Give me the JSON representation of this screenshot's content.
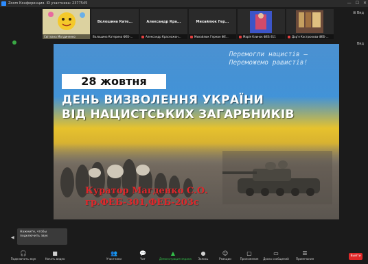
{
  "window": {
    "title": "Zoom Конференция. ID участника: 2377545",
    "controls": [
      "—",
      "☐",
      "✕"
    ]
  },
  "view_label": "⊞ Вид",
  "view_label_2": "Вид",
  "participants": [
    {
      "display": "",
      "name": "Світлана Магдиненко",
      "muted": false,
      "kind": "avatar"
    },
    {
      "display": "Волошина Кате...",
      "name": "Волошина Катерина ФЕБ-...",
      "muted": false,
      "kind": "text"
    },
    {
      "display": "Александр Кра...",
      "name": "Александр Красножон...",
      "muted": true,
      "kind": "text"
    },
    {
      "display": "Михайлюк Гер...",
      "name": "Михайлюк Герман ФЕ...",
      "muted": true,
      "kind": "text"
    },
    {
      "display": "",
      "name": "Марія Клинок ФЕБ-311",
      "muted": true,
      "kind": "photo"
    },
    {
      "display": "",
      "name": "Дар'я Кострюкова ФЕБ-...",
      "muted": true,
      "kind": "photo2"
    }
  ],
  "slide": {
    "quote_line1": "Перемогли нацистів –",
    "quote_line2": "Переможемо рашистів!",
    "date": "28 жовтня",
    "headline_line1": "ДЕНЬ ВИЗВОЛЕННЯ УКРАЇНИ",
    "headline_line2": "ВІД НАЦИСТСЬКИХ ЗАГАРБНИКІВ",
    "credit_line1": "Куратор Магденко С.О.",
    "credit_line2": "гр.ФЕБ-301,ФЕБ-203с"
  },
  "tooltip": {
    "line1": "Нажмите, чтобы",
    "line2": "подключить звук"
  },
  "toolbar": {
    "items": [
      {
        "icon": "🎧",
        "label": "Подключить звук"
      },
      {
        "icon": "■",
        "label": "Начать видео"
      },
      {
        "icon": "👥",
        "label": "Участники"
      },
      {
        "icon": "💬",
        "label": "Чат"
      },
      {
        "icon": "▲",
        "label": "Демонстрация экрана"
      },
      {
        "icon": "●",
        "label": "Запись"
      },
      {
        "icon": "☺",
        "label": "Реакции"
      },
      {
        "icon": "▢",
        "label": "Приложения"
      },
      {
        "icon": "▭",
        "label": "Доска сообщений"
      },
      {
        "icon": "☰",
        "label": "Примечания"
      }
    ],
    "end_label": "Выйти"
  },
  "colors": {
    "accent": "#2d8cff",
    "share_green": "#33c04a",
    "end_red": "#e02828",
    "credit_red": "#e2262a"
  }
}
